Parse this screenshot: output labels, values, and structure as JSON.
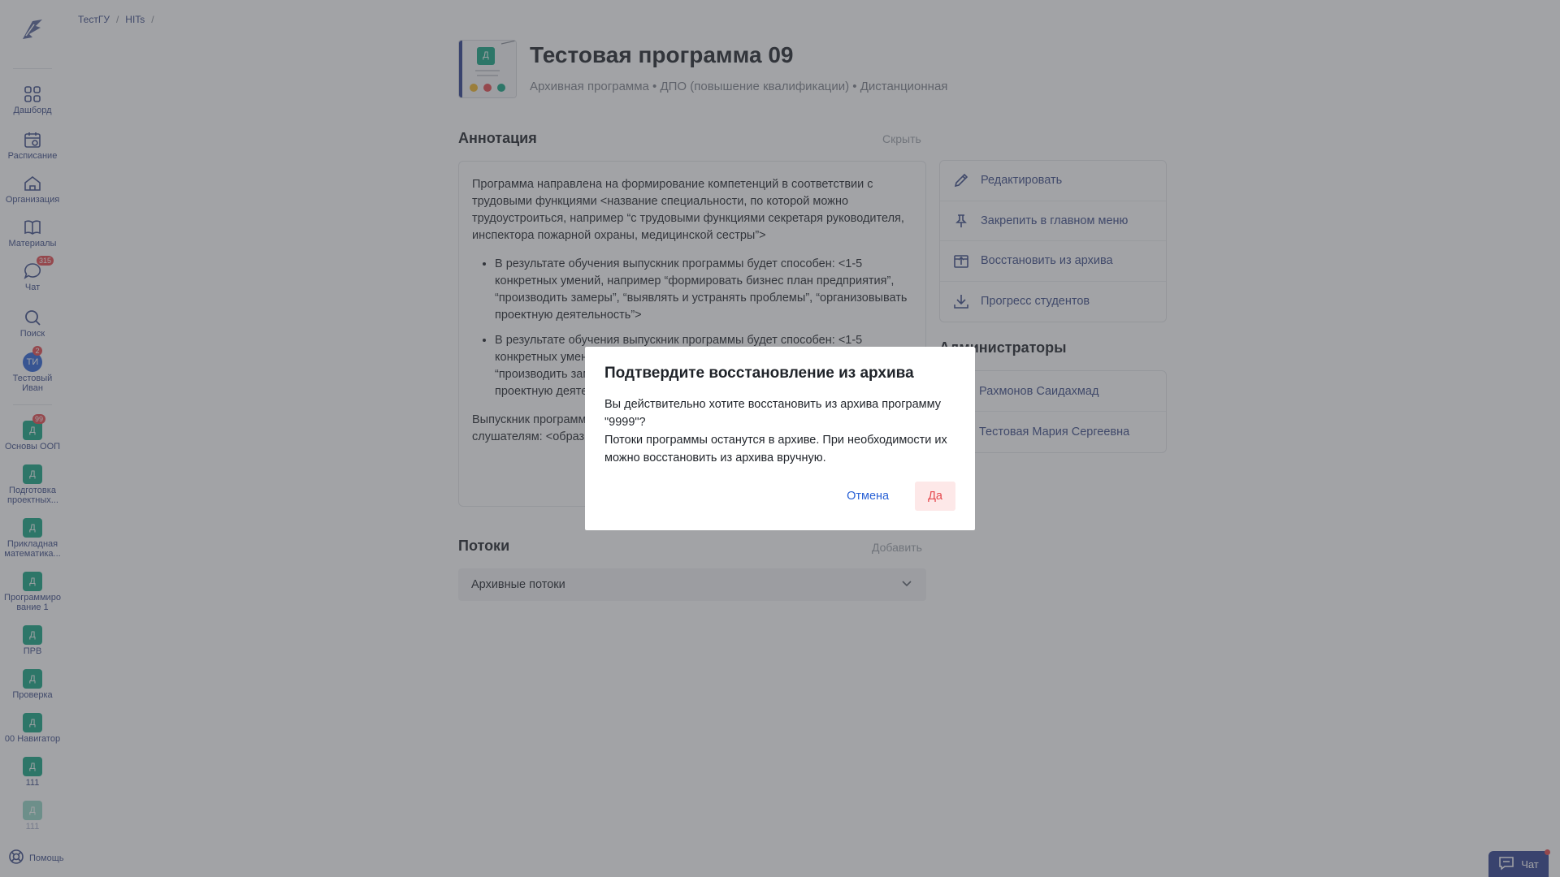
{
  "breadcrumb": [
    "ТестГУ",
    "HITs"
  ],
  "sidebar": {
    "nav": [
      {
        "label": "Дашборд",
        "icon": "grid-icon"
      },
      {
        "label": "Расписание",
        "icon": "calendar-icon"
      },
      {
        "label": "Организация",
        "icon": "home-icon"
      },
      {
        "label": "Материалы",
        "icon": "book-icon"
      },
      {
        "label": "Чат",
        "icon": "chat-icon",
        "badge": "315"
      },
      {
        "label": "Поиск",
        "icon": "search-icon"
      },
      {
        "label": "Тестовый Иван",
        "icon": "avatar-icon",
        "avatar": "ТИ",
        "badge": "2"
      }
    ],
    "courses": [
      {
        "letter": "Д",
        "label": "Основы ООП",
        "badge": "99"
      },
      {
        "letter": "Д",
        "label": "Подготовка проектных..."
      },
      {
        "letter": "Д",
        "label": "Прикладная математика..."
      },
      {
        "letter": "Д",
        "label": "Программиро вание 1"
      },
      {
        "letter": "Д",
        "label": "ПРВ"
      },
      {
        "letter": "Д",
        "label": "Проверка"
      },
      {
        "letter": "Д",
        "label": "00 Навигатор"
      },
      {
        "letter": "Д",
        "label": "111"
      },
      {
        "letter": "Д",
        "label": "111"
      }
    ],
    "help": "Помощь"
  },
  "program": {
    "title": "Тестовая программа 09",
    "subtitle": "Архивная программа • ДПО (повышение квалификации) • Дистанционная",
    "cover_letter": "Д"
  },
  "annotation": {
    "title": "Аннотация",
    "hide": "Скрыть",
    "intro": "Программа направлена на формирование компетенций в соответствии с трудовыми функциями <название специальности, по которой можно трудоустроиться, например “с трудовыми функциями секретаря руководителя, инспектора пожарной охраны, медицинской сестры”>",
    "bullets": [
      "В результате обучения выпускник программы будет способен: <1-5 конкретных умений, например “формировать бизнес план предприятия”, “производить замеры”, “выявлять и устранять проблемы”, “организовывать проектную деятельность”>",
      "В результате обучения выпускник программы будет способен: <1-5 конкретных умений, например “формировать бизнес план предприятия”, “производить замеры”, “выявлять и устранять проблемы”, “организовывать проектную деятельность”>"
    ],
    "outro": "Выпускник программы ... Заполняется в случае ... ходе стажировки на ... слушателям: <образ... считаете важным, н..."
  },
  "actions": [
    {
      "label": "Редактировать",
      "icon": "pencil-icon"
    },
    {
      "label": "Закрепить в главном меню",
      "icon": "pin-icon"
    },
    {
      "label": "Восстановить из архива",
      "icon": "unarchive-icon"
    },
    {
      "label": "Прогресс студентов",
      "icon": "download-icon"
    }
  ],
  "admins": {
    "title": "Администраторы",
    "items": [
      "Рахмонов Саидахмад",
      "Тестовая Мария Сергеевна"
    ]
  },
  "streams": {
    "title": "Потоки",
    "add": "Добавить",
    "archived": "Архивные потоки"
  },
  "chat_widget": {
    "label": "Чат"
  },
  "modal": {
    "title": "Подтвердите восстановление из архива",
    "line1": "Вы действительно хотите восстановить из архива программу \"9999\"?",
    "line2": "Потоки программы останутся в архиве. При необходимости их можно восстановить из архива вручную.",
    "cancel": "Отмена",
    "confirm": "Да"
  },
  "colors": {
    "accent": "#3a4a86",
    "link": "#2a62d6",
    "course": "#14a582",
    "badge": "#e5484d",
    "danger_bg": "#fde8e8"
  }
}
